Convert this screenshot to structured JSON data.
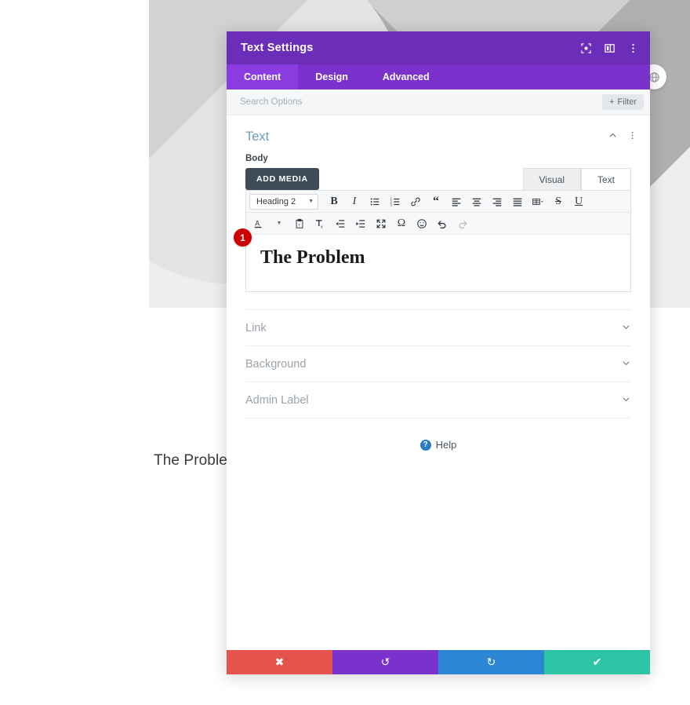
{
  "background_page": {
    "heading_text": "The Problem",
    "globe_icon": "globe-icon"
  },
  "modal": {
    "title": "Text Settings",
    "header_icons": [
      {
        "name": "focus-target-icon",
        "glyph": "target"
      },
      {
        "name": "layout-columns-icon",
        "glyph": "columns"
      },
      {
        "name": "more-vertical-icon",
        "glyph": "dots"
      }
    ],
    "tabs": [
      {
        "label": "Content",
        "active": true
      },
      {
        "label": "Design",
        "active": false
      },
      {
        "label": "Advanced",
        "active": false
      }
    ],
    "search": {
      "value": "",
      "placeholder": "Search Options"
    },
    "filter_button": {
      "label": "Filter",
      "icon": "plus-icon"
    },
    "section": {
      "title": "Text",
      "collapse_icon": "chevron-up-icon",
      "menu_icon": "more-vertical-icon"
    },
    "body_field": {
      "label": "Body",
      "add_media_label": "ADD MEDIA",
      "editor_tabs": [
        {
          "label": "Visual",
          "active": false
        },
        {
          "label": "Text",
          "active": true
        }
      ]
    },
    "editor": {
      "format_select": {
        "value": "Heading 2",
        "caret_icon": "chevron-down-icon"
      },
      "toolbar_row_1": [
        {
          "name": "bold-icon",
          "glyph": "B",
          "dim": false
        },
        {
          "name": "italic-icon",
          "glyph": "I",
          "dim": false
        },
        {
          "name": "bullet-list-icon",
          "glyph": "ul",
          "dim": false
        },
        {
          "name": "numbered-list-icon",
          "glyph": "ol",
          "dim": false
        },
        {
          "name": "link-icon",
          "glyph": "link",
          "dim": false
        },
        {
          "name": "blockquote-icon",
          "glyph": "quote",
          "dim": false
        },
        {
          "name": "align-left-icon",
          "glyph": "alignleft",
          "dim": false
        },
        {
          "name": "align-center-icon",
          "glyph": "aligncenter",
          "dim": false
        },
        {
          "name": "align-right-icon",
          "glyph": "alignright",
          "dim": false
        },
        {
          "name": "align-justify-icon",
          "glyph": "alignjustify",
          "dim": false
        },
        {
          "name": "table-icon",
          "glyph": "table",
          "dim": false
        },
        {
          "name": "strikethrough-icon",
          "glyph": "S",
          "dim": false
        },
        {
          "name": "underline-icon",
          "glyph": "U",
          "dim": false
        }
      ],
      "toolbar_row_2": [
        {
          "name": "text-color-icon",
          "glyph": "A",
          "dim": false
        },
        {
          "name": "paste-as-text-icon",
          "glyph": "paste",
          "dim": false
        },
        {
          "name": "clear-formatting-icon",
          "glyph": "Tx",
          "dim": false
        },
        {
          "name": "outdent-icon",
          "glyph": "outdent",
          "dim": false
        },
        {
          "name": "indent-icon",
          "glyph": "indent",
          "dim": false
        },
        {
          "name": "fullscreen-icon",
          "glyph": "fullscreen",
          "dim": false
        },
        {
          "name": "special-character-icon",
          "glyph": "omega",
          "dim": false
        },
        {
          "name": "emoji-icon",
          "glyph": "smiley",
          "dim": false
        },
        {
          "name": "undo-icon",
          "glyph": "undo",
          "dim": false
        },
        {
          "name": "redo-icon",
          "glyph": "redo",
          "dim": true
        }
      ],
      "content_heading": "The Problem"
    },
    "annotation_badge": "1",
    "accordion_sections": [
      {
        "label": "Link",
        "chevron": "chevron-down-icon"
      },
      {
        "label": "Background",
        "chevron": "chevron-down-icon"
      },
      {
        "label": "Admin Label",
        "chevron": "chevron-down-icon"
      }
    ],
    "help": {
      "label": "Help",
      "icon_glyph": "?"
    },
    "footer_buttons": [
      {
        "name": "cancel-button",
        "icon": "close-icon",
        "glyph": "✖",
        "color": "#e4544c"
      },
      {
        "name": "undo-button",
        "icon": "undo-icon",
        "glyph": "↺",
        "color": "#7b32cc"
      },
      {
        "name": "redo-button",
        "icon": "redo-icon",
        "glyph": "↻",
        "color": "#2b86d4"
      },
      {
        "name": "save-button",
        "icon": "check-icon",
        "glyph": "✔",
        "color": "#2ec4a6"
      }
    ]
  },
  "colors": {
    "header_purple": "#6c2eb9",
    "tabs_purple": "#7b32cc",
    "tab_active_purple": "#8b3ce0",
    "badge_red": "#cc0000",
    "section_title_blue": "#6a9ec4"
  }
}
